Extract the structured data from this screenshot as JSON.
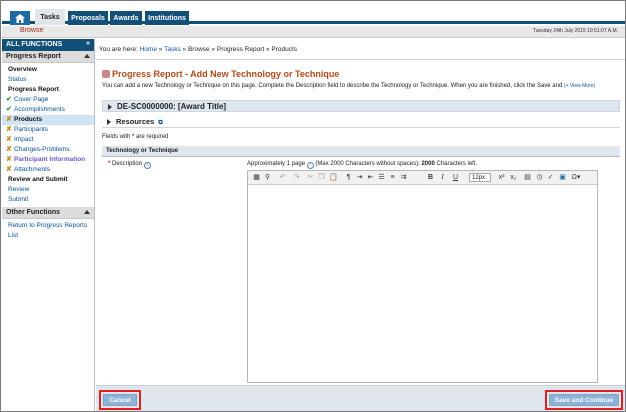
{
  "nav": {
    "tabs": [
      "Tasks",
      "Proposals",
      "Awards",
      "Institutions"
    ],
    "browse": "Browse",
    "datetime": "Tuesday 24th July 2015 10:51:07 A.M."
  },
  "sidebar": {
    "title": "ALL FUNCTIONS",
    "collapse_icon": "«",
    "section1": "Progress Report",
    "items": [
      {
        "label": "Overview",
        "style": "bold"
      },
      {
        "label": "Status",
        "style": "link"
      },
      {
        "label": "Progress Report",
        "style": "bold"
      },
      {
        "label": "Cover Page",
        "style": "check"
      },
      {
        "label": "Accomplishments",
        "style": "check"
      },
      {
        "label": "Products",
        "style": "selected"
      },
      {
        "label": "Participants",
        "style": "x"
      },
      {
        "label": "Impact",
        "style": "x"
      },
      {
        "label": "Changes-Problems",
        "style": "x"
      },
      {
        "label": "Participant Information",
        "style": "xhl"
      },
      {
        "label": "Attachments",
        "style": "x"
      },
      {
        "label": "Review and Submit",
        "style": "bold"
      },
      {
        "label": "Review",
        "style": "link"
      },
      {
        "label": "Submit",
        "style": "link"
      }
    ],
    "section2": "Other Functions",
    "other_items": [
      "Return to Progress Reports",
      "List"
    ]
  },
  "main": {
    "breadcrumb_prefix": "You are here:",
    "breadcrumb_home": "Home",
    "breadcrumb_sep": "»",
    "breadcrumb_tasks": "Tasks",
    "breadcrumb_rest": "» Browse » Progress Report » Products",
    "title": "Progress Report - Add New Technology or Technique",
    "instructions": "You can add a new Technology or Technique on this page. Complete the Description field to describe the Technology or Technique. When you are finished, click the Save and",
    "view_more": "(+ View More)",
    "award_bar": "DE-SC0000000: [Award Title]",
    "resources": "Resources",
    "required_note_a": "Fields with",
    "required_note_b": "are required",
    "section_title": "Technology or Technique",
    "description_label": "Description",
    "char_info_a": "Approximately 1 page",
    "char_info_b": "(Max 2000 Characters without spaces):",
    "char_count": "2000",
    "char_info_c": "Characters left.",
    "font_size": "12px"
  },
  "footer": {
    "cancel": "Cancel",
    "save": "Save and Continue"
  },
  "colors": {
    "nav_blue": "#12507a",
    "title_orange": "#b44a1a",
    "highlight_red": "#e02020",
    "button_blue": "#8fb3d6"
  }
}
